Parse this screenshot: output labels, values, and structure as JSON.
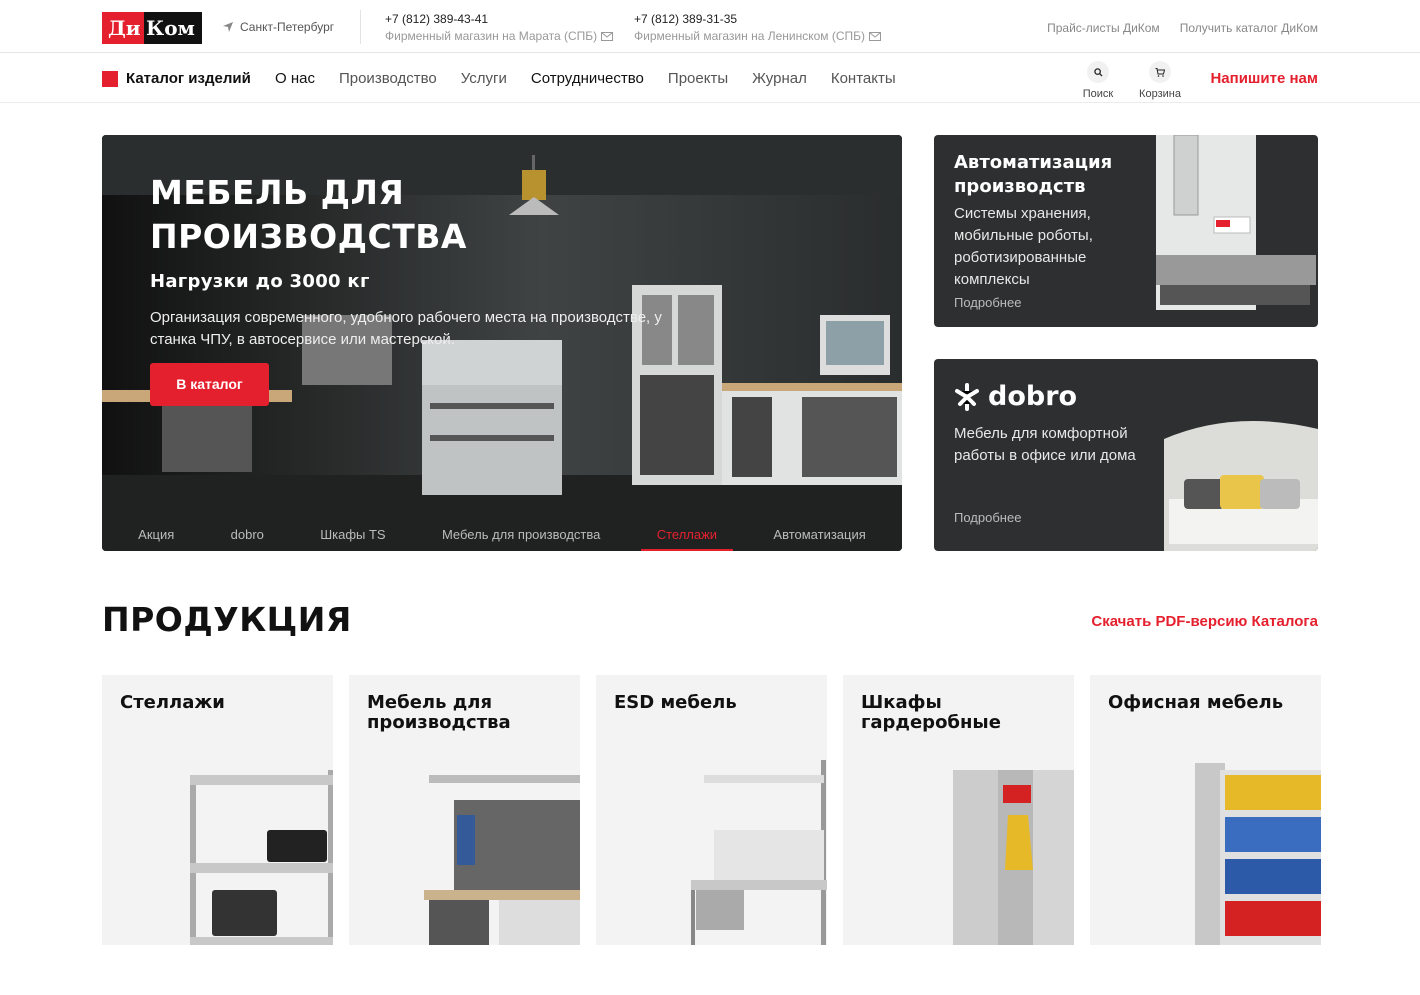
{
  "header": {
    "logo_left": "Ди",
    "logo_right": "Ком",
    "city": "Санкт-Петербург",
    "phones": [
      {
        "number": "+7 (812) 389-43-41",
        "shop": "Фирменный магазин на Марата (СПБ)"
      },
      {
        "number": "+7 (812) 389-31-35",
        "shop": "Фирменный магазин на Ленинском (СПБ)"
      }
    ],
    "links": [
      "Прайс-листы ДиКом",
      "Получить каталог ДиКом"
    ]
  },
  "nav": {
    "catalog": "Каталог изделий",
    "items": [
      "О нас",
      "Производство",
      "Услуги",
      "Сотрудничество",
      "Проекты",
      "Журнал",
      "Контакты"
    ],
    "search_label": "Поиск",
    "cart_label": "Корзина",
    "write_us": "Напишите нам"
  },
  "hero": {
    "title": "МЕБЕЛЬ ДЛЯ ПРОИЗВОДСТВА",
    "subtitle": "Нагрузки до 3000 кг",
    "text": "Организация современного, удобного рабочего места на производстве, у станка ЧПУ, в автосервисе или мастерской.",
    "button": "В каталог",
    "tabs": [
      "Акция",
      "dobro",
      "Шкафы TS",
      "Мебель для производства",
      "Стеллажи",
      "Автоматизация"
    ],
    "active_tab": "Стеллажи"
  },
  "side_cards": [
    {
      "title": "Автоматизация производств",
      "text": "Системы хранения, мобильные роботы, роботизированные комплексы",
      "more": "Подробнее"
    },
    {
      "brand": "dobro",
      "text": "Мебель для комфортной работы в офисе или дома",
      "more": "Подробнее"
    }
  ],
  "products": {
    "title": "ПРОДУКЦИЯ",
    "pdf_link": "Скачать PDF-версию Каталога",
    "items": [
      {
        "name": "Стеллажи"
      },
      {
        "name": "Мебель для производства"
      },
      {
        "name": "ESD мебель"
      },
      {
        "name": "Шкафы гардеробные"
      },
      {
        "name": "Офисная мебель"
      }
    ]
  },
  "colors": {
    "accent": "#e5202e",
    "dark_card": "#2e2f30",
    "card_bg": "#f3f3f4"
  }
}
